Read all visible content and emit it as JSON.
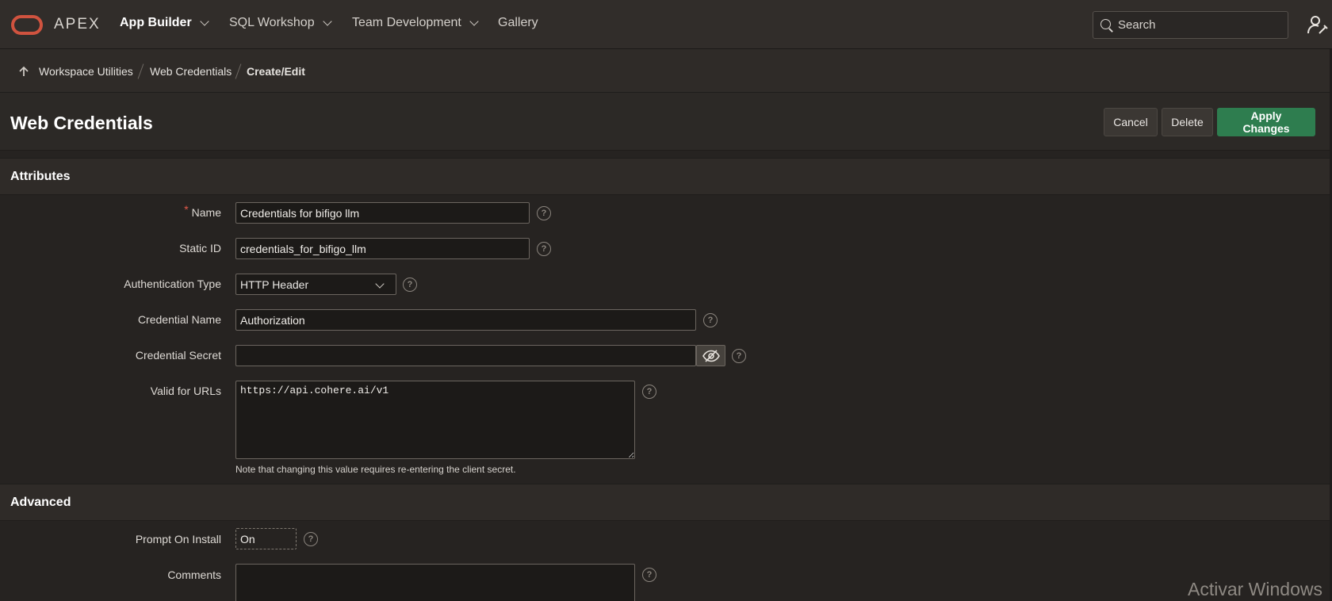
{
  "app": {
    "logo_text": "APEX",
    "accent_color": "#d0533f",
    "primary_color": "#2e7d4f"
  },
  "nav": {
    "items": [
      {
        "label": "App Builder",
        "has_menu": true,
        "active": true
      },
      {
        "label": "SQL Workshop",
        "has_menu": true,
        "active": false
      },
      {
        "label": "Team Development",
        "has_menu": true,
        "active": false
      },
      {
        "label": "Gallery",
        "has_menu": false,
        "active": false
      }
    ],
    "search_placeholder": "Search",
    "user_icon": "user-settings-icon"
  },
  "breadcrumb": {
    "items": [
      "Workspace Utilities",
      "Web Credentials"
    ],
    "current": "Create/Edit"
  },
  "page": {
    "title": "Web Credentials",
    "buttons": {
      "cancel": "Cancel",
      "delete": "Delete",
      "apply": "Apply Changes"
    }
  },
  "attributes": {
    "header": "Attributes",
    "name": {
      "label": "Name",
      "required": "*",
      "value": "Credentials for bifigo llm"
    },
    "static_id": {
      "label": "Static ID",
      "value": "credentials_for_bifigo_llm"
    },
    "auth_type": {
      "label": "Authentication Type",
      "value": "HTTP Header"
    },
    "credential_name": {
      "label": "Credential Name",
      "value": "Authorization"
    },
    "credential_secret": {
      "label": "Credential Secret",
      "value": ""
    },
    "valid_urls": {
      "label": "Valid for URLs",
      "value": "https://api.cohere.ai/v1",
      "note": "Note that changing this value requires re-entering the client secret."
    },
    "help_glyph": "?"
  },
  "advanced": {
    "header": "Advanced",
    "prompt_on_install": {
      "label": "Prompt On Install",
      "value": "On"
    },
    "comments": {
      "label": "Comments",
      "value": ""
    }
  },
  "watermark": "Activar Windows"
}
